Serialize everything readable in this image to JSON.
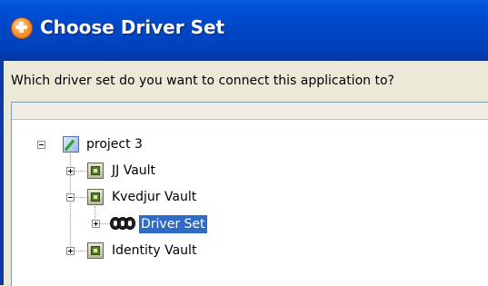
{
  "window": {
    "title": "Choose Driver Set",
    "icon": "novell-app-icon"
  },
  "dialog": {
    "prompt": "Which driver set do you want to connect this application to?"
  },
  "tree": {
    "project": {
      "label": "project 3",
      "icon": "project-icon",
      "expanded": true
    },
    "vaults": [
      {
        "label": "JJ Vault",
        "icon": "vault-icon",
        "expanded": false
      },
      {
        "label": "Kvedjur Vault",
        "icon": "vault-icon",
        "expanded": true,
        "children": [
          {
            "label": "Driver Set",
            "icon": "driver-set-icon",
            "expanded": false,
            "selected": true
          }
        ]
      },
      {
        "label": "Identity Vault",
        "icon": "vault-icon",
        "expanded": false
      }
    ]
  },
  "colors": {
    "titlebar": "#0047c7",
    "selection": "#316ac5",
    "dialog_bg": "#ece9d8"
  }
}
